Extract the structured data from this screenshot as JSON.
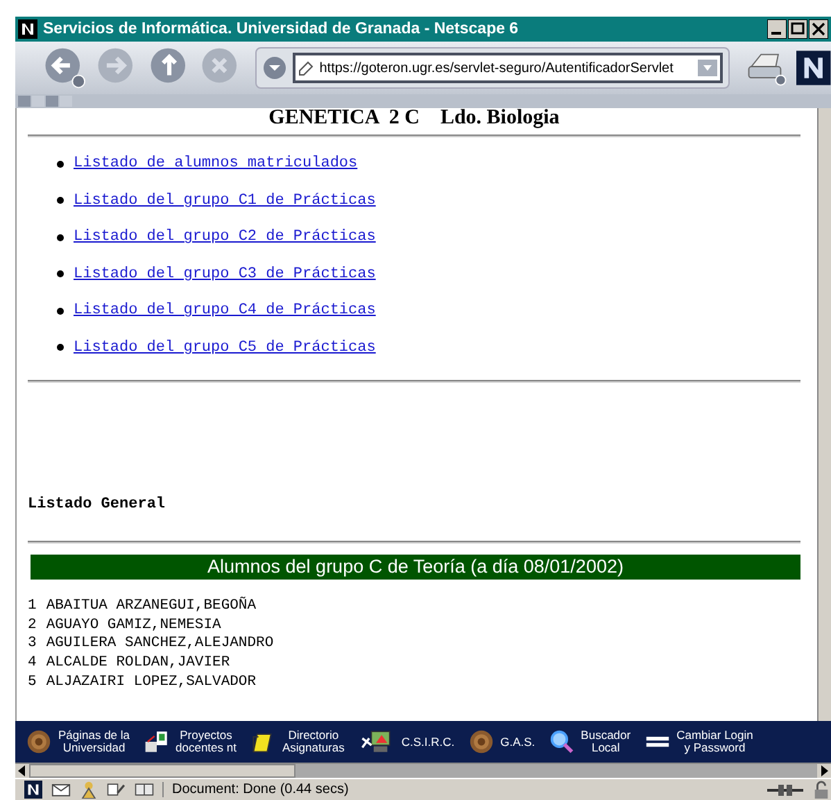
{
  "window": {
    "title": "Servicios de Informática. Universidad de Granada - Netscape 6"
  },
  "toolbar": {
    "url": "https://goteron.ugr.es/servlet-seguro/AutentificadorServlet"
  },
  "page": {
    "heading": "GENETICA  2 C    Ldo. Biologia",
    "links": [
      "Listado de alumnos matriculados",
      "Listado del grupo C1 de Prácticas",
      "Listado del grupo C2 de Prácticas",
      "Listado del grupo C3 de Prácticas",
      "Listado del grupo C4 de Prácticas",
      "Listado del grupo C5 de Prácticas"
    ],
    "section_label": "Listado General",
    "table_title": "Alumnos del grupo C de Teoría (a día 08/01/2002)",
    "students": [
      {
        "number": "1",
        "name": "ABAITUA ARZANEGUI,BEGOÑA"
      },
      {
        "number": "2",
        "name": "AGUAYO GAMIZ,NEMESIA"
      },
      {
        "number": "3",
        "name": "AGUILERA SANCHEZ,ALEJANDRO"
      },
      {
        "number": "4",
        "name": "ALCALDE ROLDAN,JAVIER"
      },
      {
        "number": "5",
        "name": "ALJAZAIRI LOPEZ,SALVADOR"
      }
    ]
  },
  "personal_toolbar": [
    {
      "kind": "seal",
      "label": "Páginas de la\nUniversidad"
    },
    {
      "kind": "computer",
      "label": "Proyectos\ndocentes nt"
    },
    {
      "kind": "folder",
      "label": "Directorio\nAsignaturas"
    },
    {
      "kind": "network",
      "label": "C.S.I.R.C."
    },
    {
      "kind": "seal",
      "label": "G.A.S."
    },
    {
      "kind": "search",
      "label": "Buscador\nLocal"
    },
    {
      "kind": "bars",
      "label": "Cambiar Login\ny Password"
    }
  ],
  "status_bar": {
    "text": "Document: Done (0.44 secs)"
  }
}
